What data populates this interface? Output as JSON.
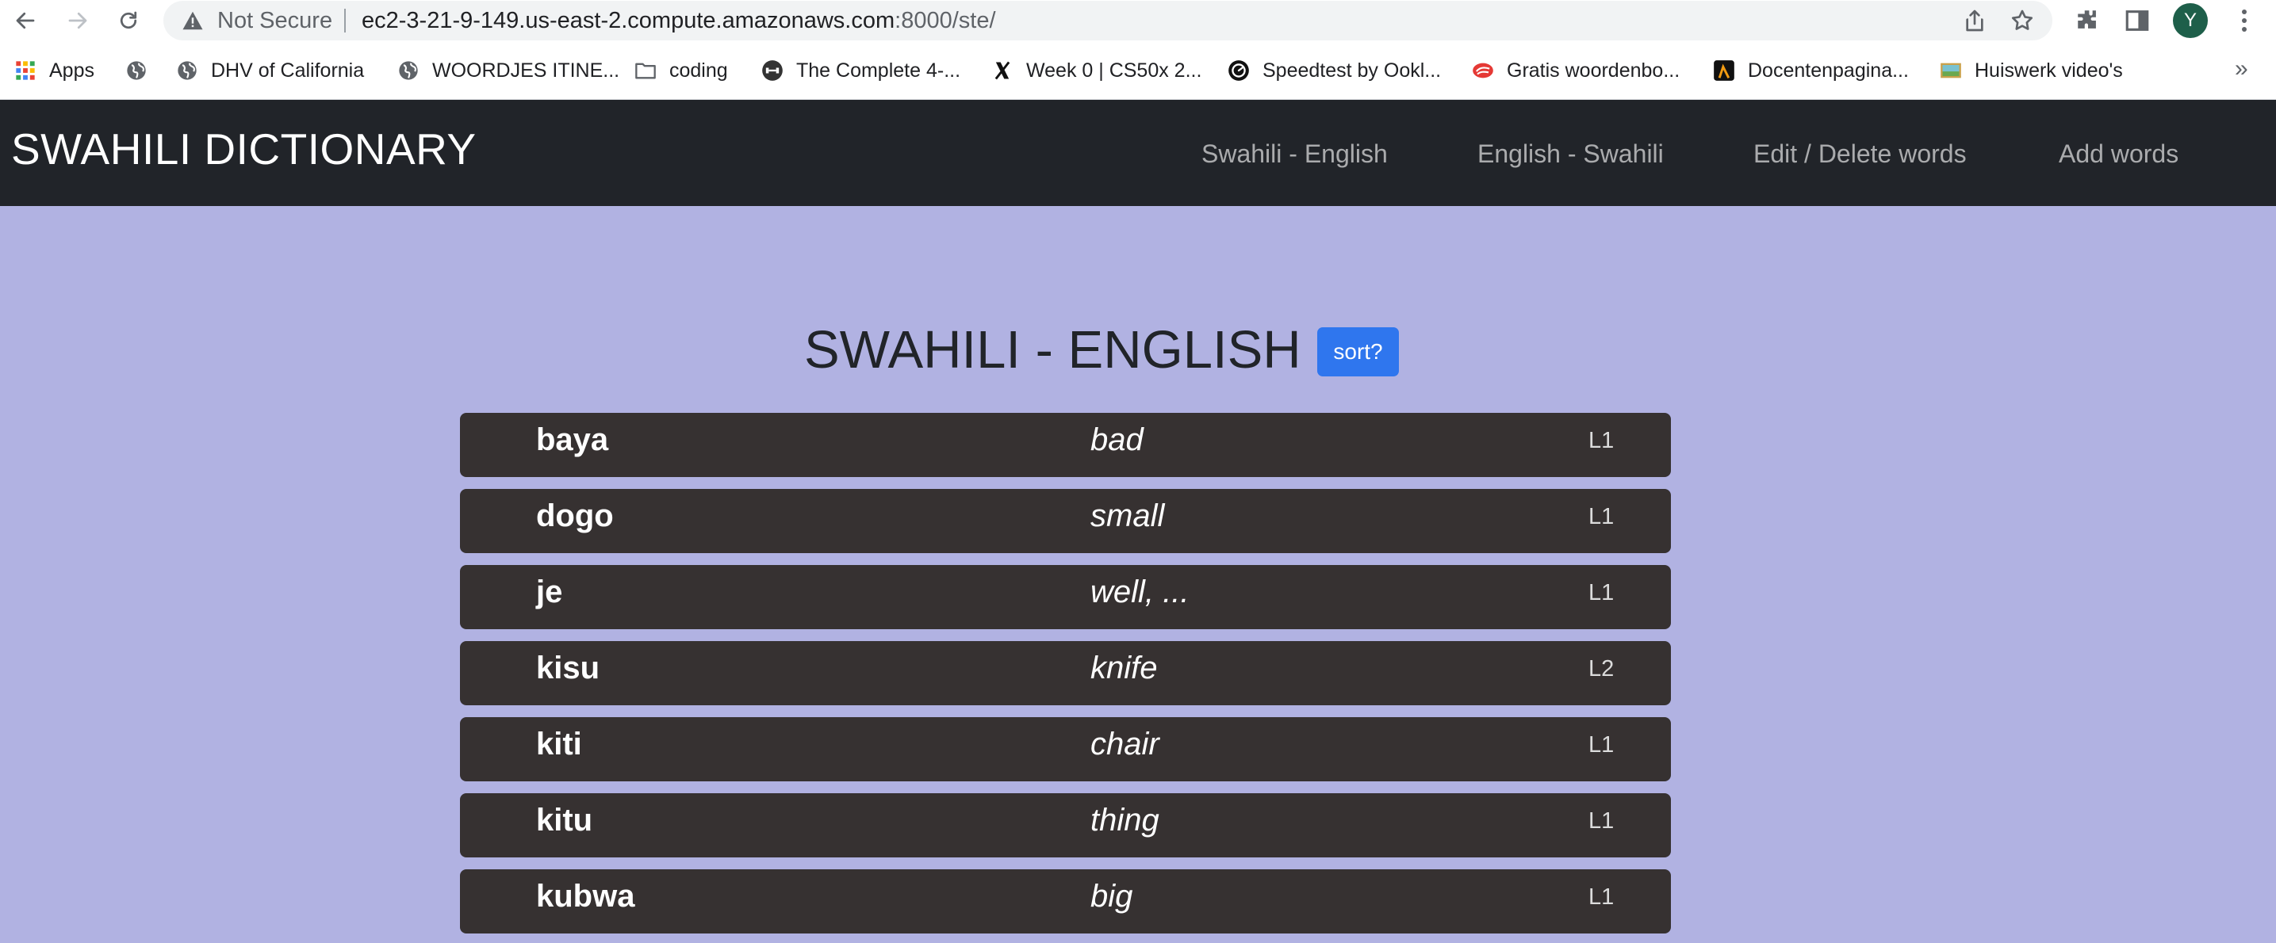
{
  "browser": {
    "security_label": "Not Secure",
    "url_host": "ec2-3-21-9-149.us-east-2.compute.amazonaws.com",
    "url_path": ":8000/ste/",
    "profile_initial": "Y"
  },
  "bookmarks": {
    "items": [
      {
        "label": "Apps",
        "icon": "apps-grid-icon"
      },
      {
        "label": "",
        "icon": "globe-icon"
      },
      {
        "label": "DHV of California",
        "icon": "globe-icon"
      },
      {
        "label": "WOORDJES ITINE...",
        "icon": "globe-icon"
      },
      {
        "label": "coding",
        "icon": "folder-icon"
      },
      {
        "label": "The Complete 4-...",
        "icon": "course-icon"
      },
      {
        "label": "Week 0 | CS50x 2...",
        "icon": "x-icon"
      },
      {
        "label": "Speedtest by Ookl...",
        "icon": "speedometer-icon"
      },
      {
        "label": "Gratis woordenbo...",
        "icon": "dictionary-icon"
      },
      {
        "label": "Docentenpagina...",
        "icon": "teacher-icon"
      },
      {
        "label": "Huiswerk video's",
        "icon": "video-icon"
      }
    ],
    "more": "»"
  },
  "navbar": {
    "brand": "SWAHILI DICTIONARY",
    "links": [
      "Swahili - English",
      "English - Swahili",
      "Edit / Delete words",
      "Add words"
    ]
  },
  "main": {
    "heading": "SWAHILI - ENGLISH",
    "sort_label": "sort?",
    "words": [
      {
        "swahili": "baya",
        "english": "bad",
        "level": "L1"
      },
      {
        "swahili": "dogo",
        "english": "small",
        "level": "L1"
      },
      {
        "swahili": "je",
        "english": "well, ...",
        "level": "L1"
      },
      {
        "swahili": "kisu",
        "english": "knife",
        "level": "L2"
      },
      {
        "swahili": "kiti",
        "english": "chair",
        "level": "L1"
      },
      {
        "swahili": "kitu",
        "english": "thing",
        "level": "L1"
      },
      {
        "swahili": "kubwa",
        "english": "big",
        "level": "L1"
      }
    ]
  },
  "colors": {
    "page_background": "#b1b2e2",
    "navbar_background": "#212429",
    "row_background": "#363131",
    "sort_button": "#2f76ee"
  }
}
